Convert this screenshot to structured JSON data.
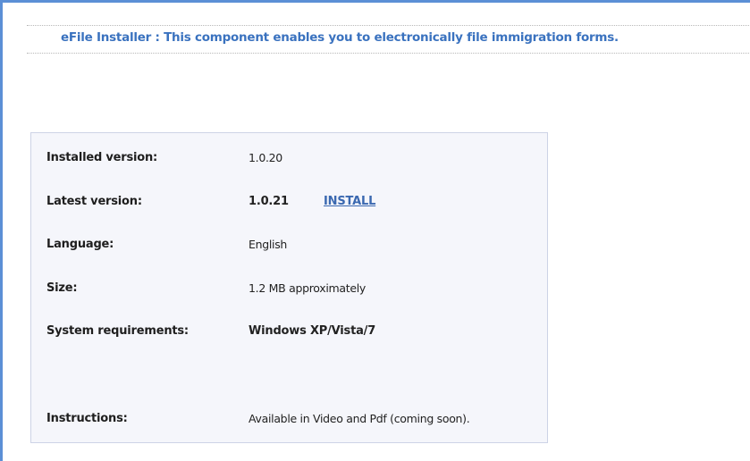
{
  "header": {
    "title": "eFile Installer : This component enables you to electronically file immigration forms."
  },
  "details": {
    "installed_version_label": "Installed version:",
    "installed_version_value": "1.0.20",
    "latest_version_label": "Latest version:",
    "latest_version_value": "1.0.21",
    "install_link": "INSTALL",
    "language_label": "Language:",
    "language_value": "English",
    "size_label": "Size:",
    "size_value": "1.2 MB approximately",
    "system_requirements_label": "System requirements:",
    "system_requirements_value": "Windows XP/Vista/7",
    "instructions_label": "Instructions:",
    "instructions_value": "Available in Video and Pdf (coming soon)."
  },
  "colors": {
    "accent_border": "#5b8fd6",
    "header_text": "#3a72bf",
    "link": "#3a68b0",
    "panel_background": "#f5f6fb",
    "panel_border": "#cdd3e6"
  }
}
